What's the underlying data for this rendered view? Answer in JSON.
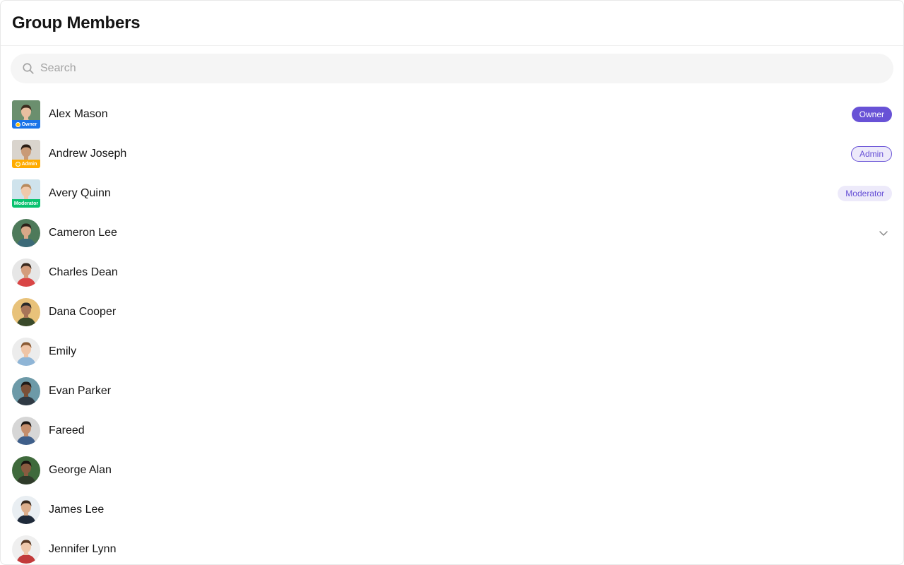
{
  "header": {
    "title": "Group Members"
  },
  "search": {
    "placeholder": "Search",
    "value": ""
  },
  "colors": {
    "accent": "#6852d6",
    "owner_strip": "#1a73e8",
    "admin_strip": "#ffab00",
    "moderator_strip": "#09c26f"
  },
  "members": [
    {
      "name": "Alex Mason",
      "scope_label": "Owner",
      "tag": "Owner",
      "avatar": {
        "bg": "#6b8f6e",
        "skin": "#e8bfa0",
        "hair": "#3b2a1c",
        "shirt": "#f2f2f2"
      }
    },
    {
      "name": "Andrew Joseph",
      "scope_label": "Admin",
      "tag": "Admin",
      "avatar": {
        "bg": "#d9d4cd",
        "skin": "#c99a76",
        "hair": "#2a1d14",
        "shirt": "#efeeea"
      }
    },
    {
      "name": "Avery Quinn",
      "scope_label": "Moderator",
      "tag": "Moderator",
      "avatar": {
        "bg": "#cfe3ec",
        "skin": "#f0c9aa",
        "hair": "#b88a5c",
        "shirt": "#dce9f0"
      }
    },
    {
      "name": "Cameron Lee",
      "avatar": {
        "bg": "#4e7a5a",
        "skin": "#d7a888",
        "hair": "#2b2018",
        "shirt": "#3c6a78"
      }
    },
    {
      "name": "Charles Dean",
      "avatar": {
        "bg": "#e6e6e6",
        "skin": "#d49d7c",
        "hair": "#3a2a1f",
        "shirt": "#d94545"
      }
    },
    {
      "name": "Dana Cooper",
      "avatar": {
        "bg": "#e8c27a",
        "skin": "#a77558",
        "hair": "#2a2a2a",
        "shirt": "#3a4a2a"
      }
    },
    {
      "name": "Emily",
      "avatar": {
        "bg": "#ececec",
        "skin": "#f0c5a6",
        "hair": "#8a5a34",
        "shirt": "#8fb5d6"
      }
    },
    {
      "name": "Evan Parker",
      "avatar": {
        "bg": "#6d9aa8",
        "skin": "#7a5038",
        "hair": "#1e1a18",
        "shirt": "#2f3a44"
      }
    },
    {
      "name": "Fareed",
      "avatar": {
        "bg": "#d6d6d6",
        "skin": "#c58e6c",
        "hair": "#1c1714",
        "shirt": "#3f5f8a"
      }
    },
    {
      "name": "George Alan",
      "avatar": {
        "bg": "#3f6a3c",
        "skin": "#8a5b40",
        "hair": "#1a1410",
        "shirt": "#2f3b2a"
      }
    },
    {
      "name": "James Lee",
      "avatar": {
        "bg": "#e9eef2",
        "skin": "#dcae8c",
        "hair": "#3a2a1e",
        "shirt": "#1f2a3a"
      }
    },
    {
      "name": "Jennifer Lynn",
      "avatar": {
        "bg": "#efefef",
        "skin": "#efc8ab",
        "hair": "#5a3a24",
        "shirt": "#c23a3a"
      }
    }
  ]
}
